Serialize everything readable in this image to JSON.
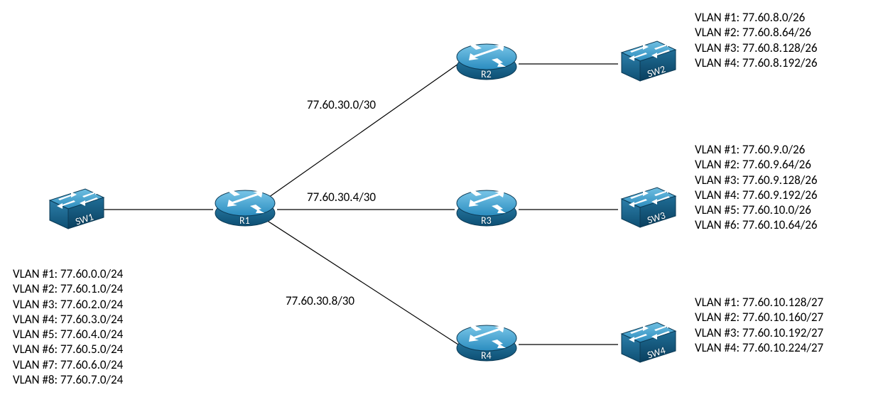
{
  "devices": {
    "sw1": {
      "label": "SW1"
    },
    "sw2": {
      "label": "SW2"
    },
    "sw3": {
      "label": "SW3"
    },
    "sw4": {
      "label": "SW4"
    },
    "r1": {
      "label": "R1"
    },
    "r2": {
      "label": "R2"
    },
    "r3": {
      "label": "R3"
    },
    "r4": {
      "label": "R4"
    }
  },
  "links": {
    "r1_r2": {
      "subnet": "77.60.30.0/30"
    },
    "r1_r3": {
      "subnet": "77.60.30.4/30"
    },
    "r1_r4": {
      "subnet": "77.60.30.8/30"
    }
  },
  "vlans": {
    "sw1": [
      "VLAN #1: 77.60.0.0/24",
      "VLAN #2: 77.60.1.0/24",
      "VLAN #3: 77.60.2.0/24",
      "VLAN #4: 77.60.3.0/24",
      "VLAN #5: 77.60.4.0/24",
      "VLAN #6: 77.60.5.0/24",
      "VLAN #7: 77.60.6.0/24",
      "VLAN #8: 77.60.7.0/24"
    ],
    "sw2": [
      "VLAN #1: 77.60.8.0/26",
      "VLAN #2: 77.60.8.64/26",
      "VLAN #3: 77.60.8.128/26",
      "VLAN #4: 77.60.8.192/26"
    ],
    "sw3": [
      "VLAN #1: 77.60.9.0/26",
      "VLAN #2: 77.60.9.64/26",
      "VLAN #3: 77.60.9.128/26",
      "VLAN #4: 77.60.9.192/26",
      "VLAN #5: 77.60.10.0/26",
      "VLAN #6: 77.60.10.64/26"
    ],
    "sw4": [
      "VLAN #1: 77.60.10.128/27",
      "VLAN #2: 77.60.10.160/27",
      "VLAN #3: 77.60.10.192/27",
      "VLAN #4: 77.60.10.224/27"
    ]
  },
  "chart_data": {
    "type": "diagram",
    "description": "Network topology: central router R1 connected to switch SW1 and three remote routers R2, R3, R4 via /30 point-to-point links; each remote router connects to a switch hosting multiple VLANs.",
    "nodes": [
      {
        "id": "SW1",
        "type": "switch"
      },
      {
        "id": "SW2",
        "type": "switch"
      },
      {
        "id": "SW3",
        "type": "switch"
      },
      {
        "id": "SW4",
        "type": "switch"
      },
      {
        "id": "R1",
        "type": "router"
      },
      {
        "id": "R2",
        "type": "router"
      },
      {
        "id": "R3",
        "type": "router"
      },
      {
        "id": "R4",
        "type": "router"
      }
    ],
    "edges": [
      {
        "from": "SW1",
        "to": "R1"
      },
      {
        "from": "R1",
        "to": "R2",
        "subnet": "77.60.30.0/30"
      },
      {
        "from": "R1",
        "to": "R3",
        "subnet": "77.60.30.4/30"
      },
      {
        "from": "R1",
        "to": "R4",
        "subnet": "77.60.30.8/30"
      },
      {
        "from": "R2",
        "to": "SW2"
      },
      {
        "from": "R3",
        "to": "SW3"
      },
      {
        "from": "R4",
        "to": "SW4"
      }
    ],
    "vlans": {
      "SW1": [
        {
          "vlan": 1,
          "network": "77.60.0.0/24"
        },
        {
          "vlan": 2,
          "network": "77.60.1.0/24"
        },
        {
          "vlan": 3,
          "network": "77.60.2.0/24"
        },
        {
          "vlan": 4,
          "network": "77.60.3.0/24"
        },
        {
          "vlan": 5,
          "network": "77.60.4.0/24"
        },
        {
          "vlan": 6,
          "network": "77.60.5.0/24"
        },
        {
          "vlan": 7,
          "network": "77.60.6.0/24"
        },
        {
          "vlan": 8,
          "network": "77.60.7.0/24"
        }
      ],
      "SW2": [
        {
          "vlan": 1,
          "network": "77.60.8.0/26"
        },
        {
          "vlan": 2,
          "network": "77.60.8.64/26"
        },
        {
          "vlan": 3,
          "network": "77.60.8.128/26"
        },
        {
          "vlan": 4,
          "network": "77.60.8.192/26"
        }
      ],
      "SW3": [
        {
          "vlan": 1,
          "network": "77.60.9.0/26"
        },
        {
          "vlan": 2,
          "network": "77.60.9.64/26"
        },
        {
          "vlan": 3,
          "network": "77.60.9.128/26"
        },
        {
          "vlan": 4,
          "network": "77.60.9.192/26"
        },
        {
          "vlan": 5,
          "network": "77.60.10.0/26"
        },
        {
          "vlan": 6,
          "network": "77.60.10.64/26"
        }
      ],
      "SW4": [
        {
          "vlan": 1,
          "network": "77.60.10.128/27"
        },
        {
          "vlan": 2,
          "network": "77.60.10.160/27"
        },
        {
          "vlan": 3,
          "network": "77.60.10.192/27"
        },
        {
          "vlan": 4,
          "network": "77.60.10.224/27"
        }
      ]
    }
  }
}
